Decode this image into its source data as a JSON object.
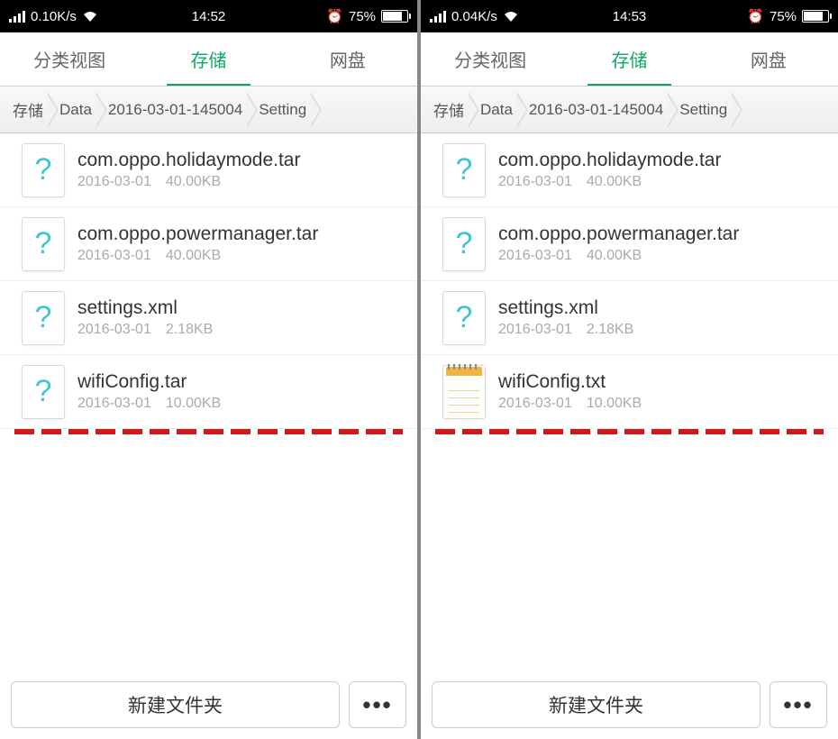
{
  "screens": [
    {
      "status": {
        "speed": "0.10K/s",
        "time": "14:52",
        "battery": "75%"
      },
      "tabs": [
        {
          "label": "分类视图",
          "active": false
        },
        {
          "label": "存储",
          "active": true
        },
        {
          "label": "网盘",
          "active": false
        }
      ],
      "breadcrumb": [
        "存储",
        "Data",
        "2016-03-01-145004",
        "Setting"
      ],
      "files": [
        {
          "icon": "unknown",
          "name": "com.oppo.holidaymode.tar",
          "date": "2016-03-01",
          "size": "40.00KB"
        },
        {
          "icon": "unknown",
          "name": "com.oppo.powermanager.tar",
          "date": "2016-03-01",
          "size": "40.00KB"
        },
        {
          "icon": "unknown",
          "name": "settings.xml",
          "date": "2016-03-01",
          "size": "2.18KB"
        },
        {
          "icon": "unknown",
          "name": "wifiConfig.tar",
          "date": "2016-03-01",
          "size": "10.00KB"
        }
      ],
      "bottom": {
        "new_folder": "新建文件夹",
        "more": "•••"
      }
    },
    {
      "status": {
        "speed": "0.04K/s",
        "time": "14:53",
        "battery": "75%"
      },
      "tabs": [
        {
          "label": "分类视图",
          "active": false
        },
        {
          "label": "存储",
          "active": true
        },
        {
          "label": "网盘",
          "active": false
        }
      ],
      "breadcrumb": [
        "存储",
        "Data",
        "2016-03-01-145004",
        "Setting"
      ],
      "files": [
        {
          "icon": "unknown",
          "name": "com.oppo.holidaymode.tar",
          "date": "2016-03-01",
          "size": "40.00KB"
        },
        {
          "icon": "unknown",
          "name": "com.oppo.powermanager.tar",
          "date": "2016-03-01",
          "size": "40.00KB"
        },
        {
          "icon": "unknown",
          "name": "settings.xml",
          "date": "2016-03-01",
          "size": "2.18KB"
        },
        {
          "icon": "note",
          "name": "wifiConfig.txt",
          "date": "2016-03-01",
          "size": "10.00KB"
        }
      ],
      "bottom": {
        "new_folder": "新建文件夹",
        "more": "•••"
      }
    }
  ]
}
